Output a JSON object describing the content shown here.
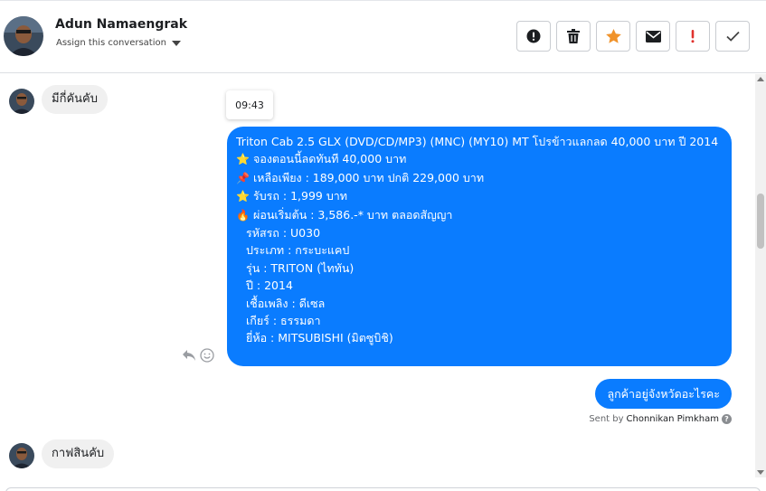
{
  "header": {
    "contact_name": "Adun Namaengrak",
    "assign_label": "Assign this conversation",
    "actions": [
      {
        "name": "mark-spam-button",
        "icon": "exclamation-circle-icon"
      },
      {
        "name": "delete-button",
        "icon": "trash-icon"
      },
      {
        "name": "star-button",
        "icon": "star-icon",
        "color": "#f0932b"
      },
      {
        "name": "mark-unread-button",
        "icon": "envelope-icon"
      },
      {
        "name": "follow-up-button",
        "icon": "exclamation-icon",
        "color": "#e0322d"
      },
      {
        "name": "mark-done-button",
        "icon": "check-icon"
      }
    ]
  },
  "conversation": {
    "incoming_1": "มีกี่คันคับ",
    "tooltip_time": "09:43",
    "outgoing_1": {
      "line1": "Triton Cab 2.5 GLX (DVD/CD/MP3) (MNC) (MY10) MT โปรข้าวแลกลด 40,000 บาท ปี 2014",
      "line2": "จองตอนนี้ลดทันที 40,000 บาท",
      "line3": "เหลือเพียง : 189,000 บาท ปกติ 229,000 บาท",
      "line4": "รับรถ : 1,999 บาท",
      "line5": "ผ่อนเริ่มต้น : 3,586.-* บาท ตลอดสัญญา",
      "line6": "รหัสรถ : U030",
      "line7": "ประเภท : กระบะแคป",
      "line8": "รุ่น : TRITON (ไททัน)",
      "line9": "ปี : 2014",
      "line10": "เชื้อเพลิง : ดีเซล",
      "line11": "เกียร์ : ธรรมดา",
      "line12": "ยี่ห้อ : MITSUBISHI (มิตซูบิชิ)"
    },
    "outgoing_2": "ลูกค้าอยู่จังหวัดอะไรคะ",
    "sent_by_prefix": "Sent by",
    "sent_by_name": "Chonnikan Pimkham",
    "incoming_2": "กาฟสินคับ"
  },
  "colors": {
    "outgoing_bubble": "#0a7cff",
    "incoming_bubble": "#f0f0f0",
    "star": "#f0932b",
    "follow_up": "#e0322d"
  }
}
